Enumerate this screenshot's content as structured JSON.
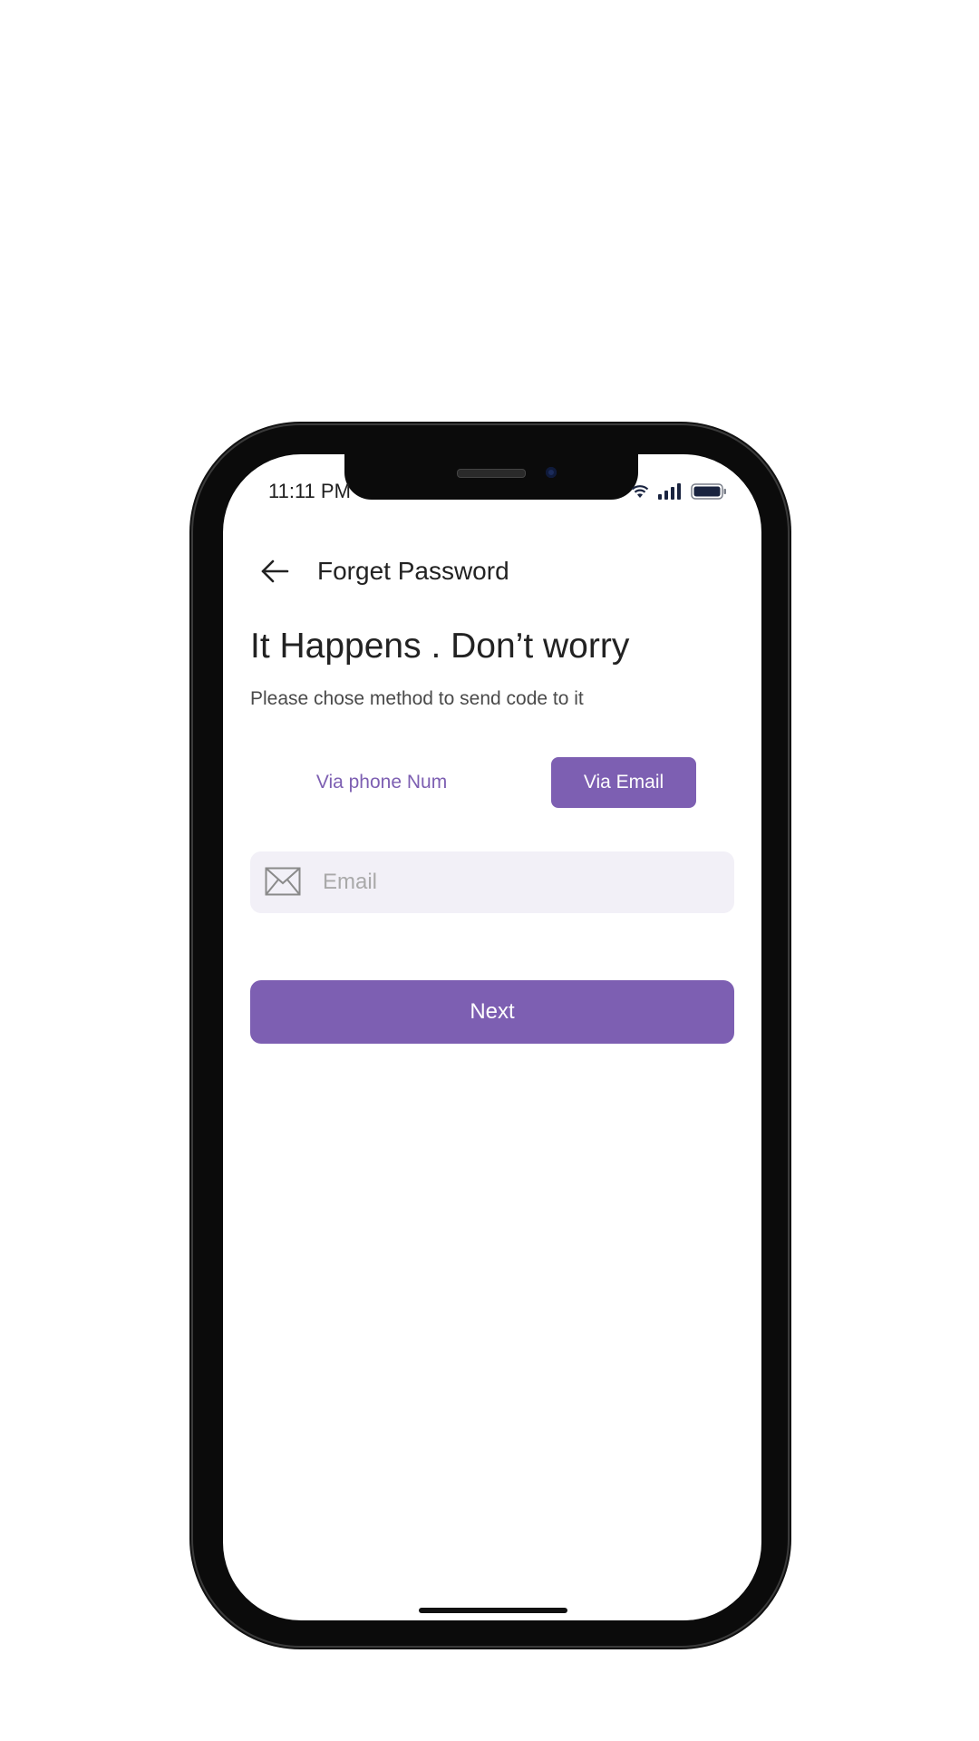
{
  "status_bar": {
    "time": "11:11 PM",
    "icons": [
      "wifi-icon",
      "signal-icon",
      "battery-icon"
    ]
  },
  "header": {
    "back_icon": "arrow-left-icon",
    "title": "Forget Password"
  },
  "content": {
    "headline": "It Happens . Don’t worry",
    "subtitle": "Please chose method to send code to it"
  },
  "method_tabs": {
    "phone_label": "Via phone Num",
    "email_label": "Via Email",
    "selected": "Via Email"
  },
  "email_field": {
    "icon": "envelope-icon",
    "placeholder": "Email",
    "value": ""
  },
  "next_button": {
    "label": "Next"
  },
  "colors": {
    "accent": "#7d5fb2",
    "field_background": "#f2f0f7",
    "text_primary": "#222222"
  }
}
